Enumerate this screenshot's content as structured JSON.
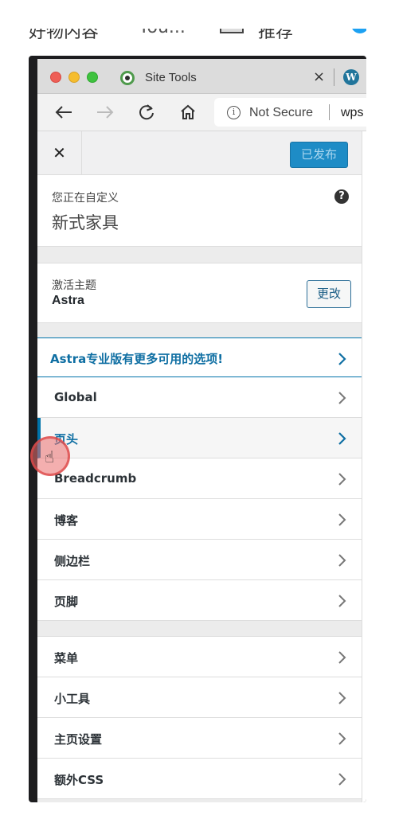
{
  "background_fragments": {
    "left_text": "好物内容",
    "mid_text": "You...",
    "right_text": "推荐"
  },
  "browser": {
    "tab_title": "Site Tools",
    "close_glyph": "×",
    "wp_glyph": "W",
    "security_label": "Not Secure",
    "url_text": "wps"
  },
  "header": {
    "close_glyph": "✕",
    "publish_label": "已发布"
  },
  "info": {
    "label": "您正在自定义",
    "site_name": "新式家具",
    "help_glyph": "?"
  },
  "theme": {
    "label": "激活主题",
    "name": "Astra",
    "change_label": "更改"
  },
  "promo": {
    "text": "Astra专业版有更多可用的选项!"
  },
  "menu_group_1": [
    {
      "label": "Global"
    },
    {
      "label": "页头"
    },
    {
      "label": "Breadcrumb"
    },
    {
      "label": "博客"
    },
    {
      "label": "侧边栏"
    },
    {
      "label": "页脚"
    }
  ],
  "menu_group_2": [
    {
      "label": "菜单"
    },
    {
      "label": "小工具"
    },
    {
      "label": "主页设置"
    },
    {
      "label": "额外CSS"
    }
  ],
  "colors": {
    "accent": "#0073aa",
    "publish": "#1e8cc6"
  }
}
